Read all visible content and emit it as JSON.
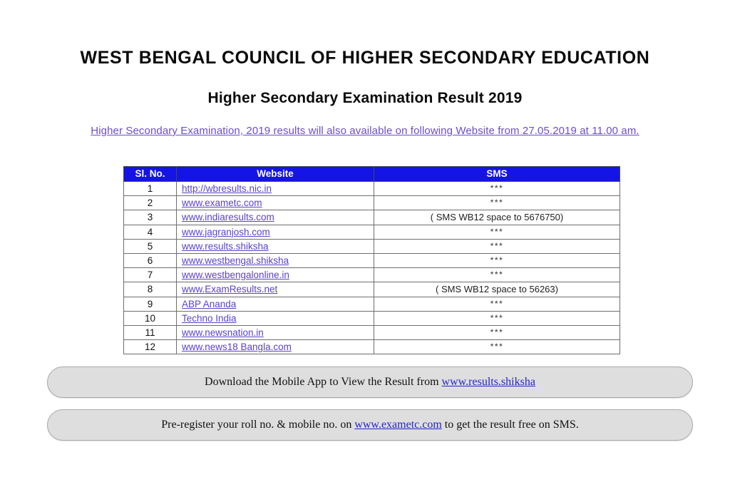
{
  "header": {
    "title": "WEST BENGAL COUNCIL OF HIGHER SECONDARY EDUCATION",
    "subtitle": "Higher Secondary Examination Result 2019",
    "notice": "Higher Secondary Examination, 2019 results will also available on following Website from 27.05.2019 at 11.00 am."
  },
  "table": {
    "columns": [
      "Sl. No.",
      "Website",
      "SMS"
    ],
    "rows": [
      {
        "sl": "1",
        "website": "http://wbresults.nic.in",
        "sms": "***"
      },
      {
        "sl": "2",
        "website": "www.exametc.com",
        "sms": "***"
      },
      {
        "sl": "3",
        "website": "www.indiaresults.com",
        "sms": "( SMS WB12 space to 5676750)"
      },
      {
        "sl": "4",
        "website": "www.jagranjosh.com",
        "sms": "***"
      },
      {
        "sl": "5",
        "website": "www.results.shiksha",
        "sms": "***"
      },
      {
        "sl": "6",
        "website": "www.westbengal.shiksha",
        "sms": "***"
      },
      {
        "sl": "7",
        "website": "www.westbengalonline.in",
        "sms": "***"
      },
      {
        "sl": "8",
        "website": "www.ExamResults.net",
        "sms": "( SMS WB12 space to 56263)"
      },
      {
        "sl": "9",
        "website": "ABP Ananda",
        "sms": "***"
      },
      {
        "sl": "10",
        "website": "Techno India",
        "sms": "***"
      },
      {
        "sl": "11",
        "website": "www.newsnation.in",
        "sms": "***"
      },
      {
        "sl": "12",
        "website": "www.news18 Bangla.com",
        "sms": "***"
      }
    ]
  },
  "buttons": {
    "download": {
      "prefix": "Download the Mobile App to View the Result from ",
      "link": "www.results.shiksha",
      "suffix": ""
    },
    "preregister": {
      "prefix": "Pre-register your roll no. & mobile no. on ",
      "link": "www.exametc.com",
      "suffix": " to get the result free on SMS."
    }
  },
  "colors": {
    "header_blue": "#1414e6",
    "link_violet": "#5b42c8",
    "notice_violet": "#6b4fc4",
    "pill_fill": "#dedede",
    "pill_border": "#a9a9a9",
    "pill_link": "#2424cc"
  }
}
